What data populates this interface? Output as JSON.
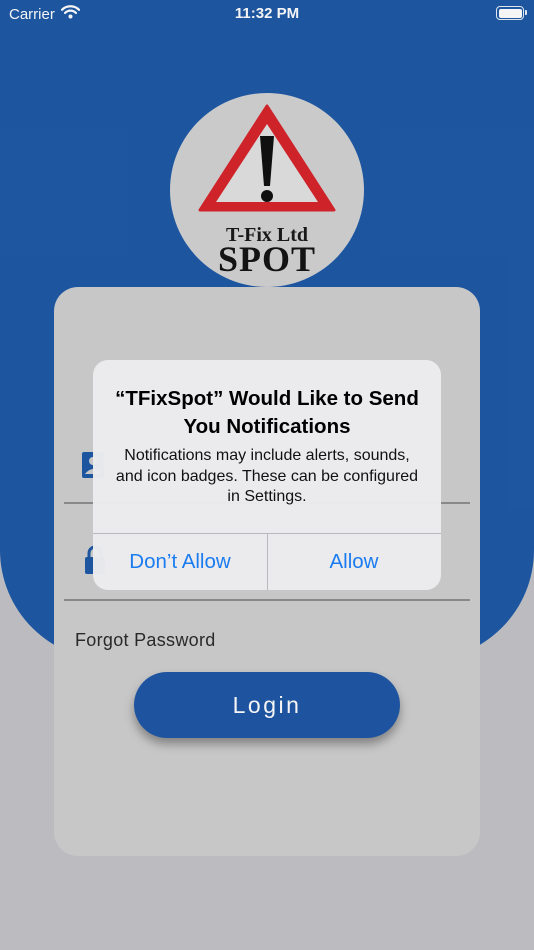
{
  "status_bar": {
    "carrier": "Carrier",
    "time": "11:32 PM",
    "wifi_icon": "wifi-icon",
    "battery_icon": "battery-icon"
  },
  "logo": {
    "line1": "T-Fix Ltd",
    "line2": "SPOT",
    "mark": "exclamation-warning-triangle"
  },
  "login_form": {
    "username_icon": "user-icon",
    "password_icon": "lock-icon",
    "forgot_password": "Forgot Password",
    "login_button": "Login"
  },
  "alert": {
    "title": "“TFixSpot” Would Like to Send You Notifications",
    "message": "Notifications may include alerts, sounds, and icon badges. These can be configured in Settings.",
    "dont_allow": "Don’t Allow",
    "allow": "Allow"
  },
  "colors": {
    "brand_blue": "#1f5aa6",
    "system_blue": "#1a7cf0",
    "card_gray": "#d0d0d1",
    "background_gray": "#c4c4c8",
    "warning_red": "#d8252c"
  }
}
